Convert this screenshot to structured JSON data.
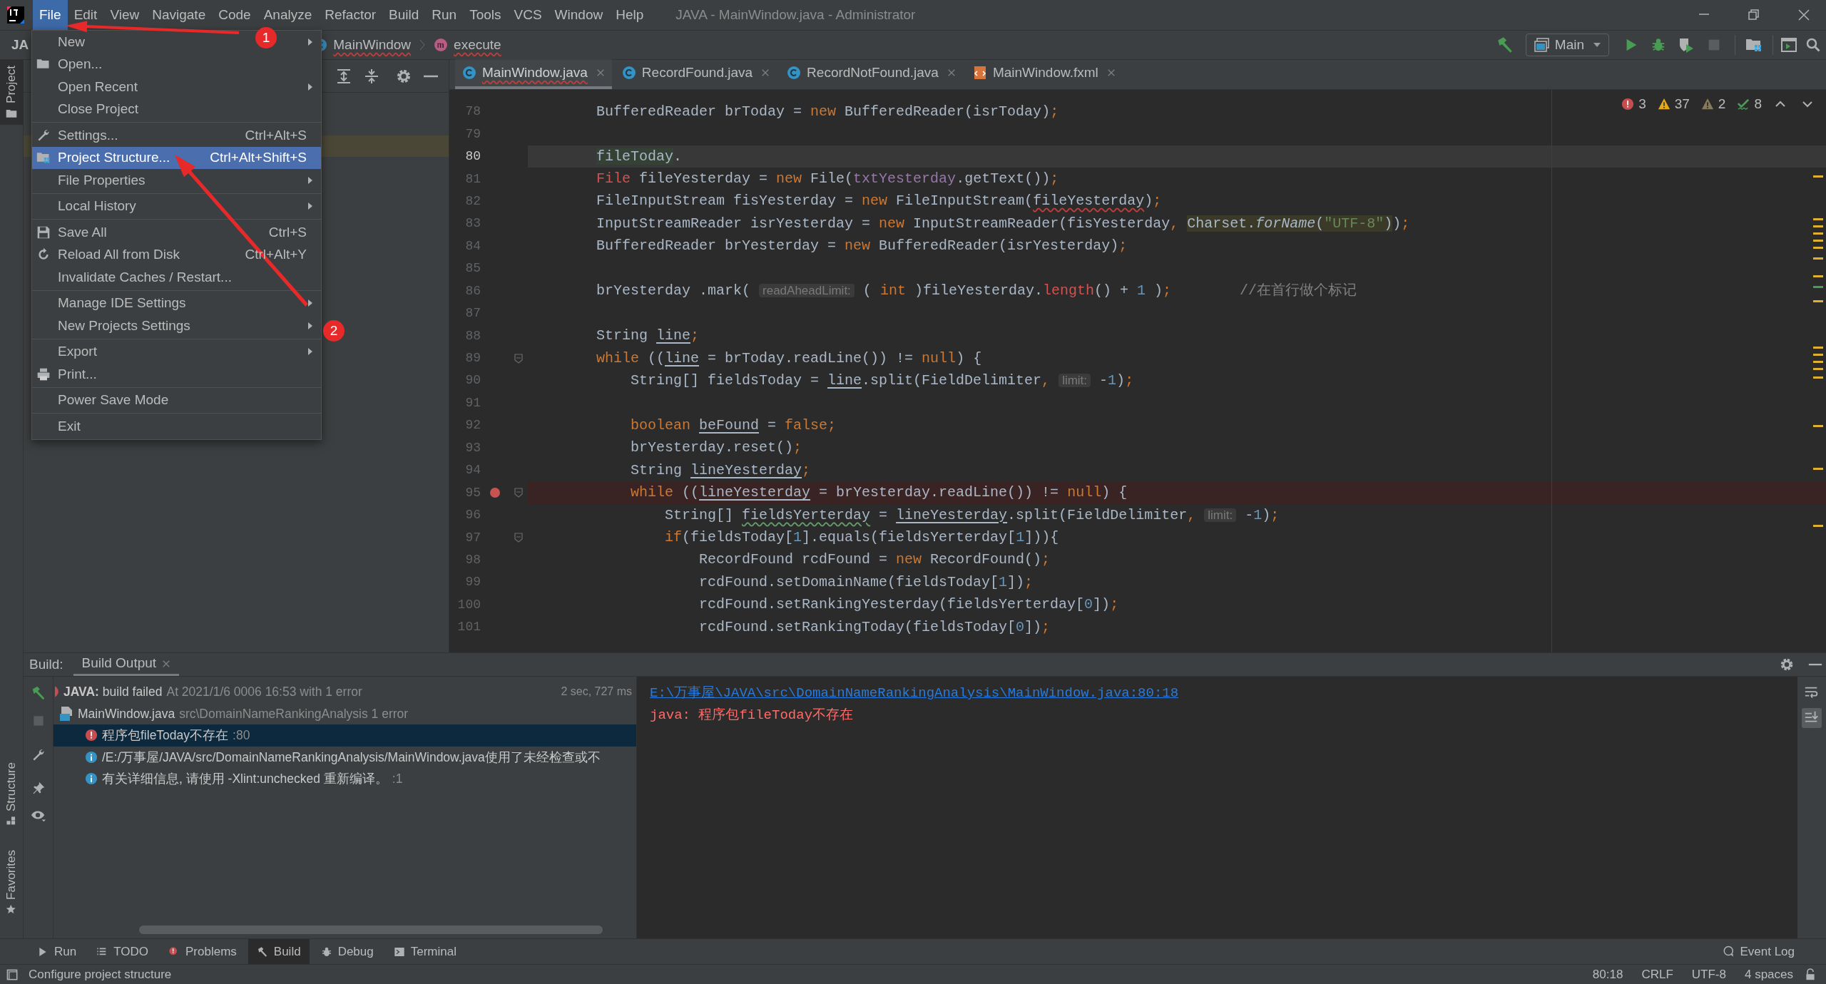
{
  "window": {
    "title": "JAVA - MainWindow.java - Administrator"
  },
  "menu_bar": [
    {
      "label": "File",
      "selected": true
    },
    {
      "label": "Edit",
      "selected": false
    },
    {
      "label": "View",
      "selected": false
    },
    {
      "label": "Navigate",
      "selected": false
    },
    {
      "label": "Code",
      "selected": false
    },
    {
      "label": "Analyze",
      "selected": false
    },
    {
      "label": "Refactor",
      "selected": false
    },
    {
      "label": "Build",
      "selected": false
    },
    {
      "label": "Run",
      "selected": false
    },
    {
      "label": "Tools",
      "selected": false
    },
    {
      "label": "VCS",
      "selected": false
    },
    {
      "label": "Window",
      "selected": false
    },
    {
      "label": "Help",
      "selected": false
    }
  ],
  "navigation": {
    "project": "JA",
    "breadcrumbs": [
      {
        "label": "MainWindow",
        "kind": "class",
        "error": true
      },
      {
        "label": "execute",
        "kind": "method",
        "error": true
      }
    ]
  },
  "run_configuration": "Main",
  "file_menu": [
    {
      "kind": "item",
      "label": "New",
      "submenu": true,
      "selected": false
    },
    {
      "kind": "item",
      "label": "Open...",
      "submenu": false,
      "selected": false
    },
    {
      "kind": "item",
      "label": "Open Recent",
      "submenu": true,
      "selected": false
    },
    {
      "kind": "item",
      "label": "Close Project",
      "submenu": false,
      "selected": false
    },
    {
      "kind": "separator"
    },
    {
      "kind": "item",
      "label": "Settings...",
      "shortcut": "Ctrl+Alt+S",
      "submenu": false,
      "selected": false
    },
    {
      "kind": "item",
      "label": "Project Structure...",
      "shortcut": "Ctrl+Alt+Shift+S",
      "submenu": false,
      "selected": true
    },
    {
      "kind": "item",
      "label": "File Properties",
      "submenu": true,
      "selected": false
    },
    {
      "kind": "separator"
    },
    {
      "kind": "item",
      "label": "Local History",
      "submenu": true,
      "selected": false
    },
    {
      "kind": "separator"
    },
    {
      "kind": "item",
      "label": "Save All",
      "shortcut": "Ctrl+S",
      "submenu": false,
      "selected": false
    },
    {
      "kind": "item",
      "label": "Reload All from Disk",
      "shortcut": "Ctrl+Alt+Y",
      "submenu": false,
      "selected": false
    },
    {
      "kind": "item",
      "label": "Invalidate Caches / Restart...",
      "submenu": false,
      "selected": false
    },
    {
      "kind": "separator"
    },
    {
      "kind": "item",
      "label": "Manage IDE Settings",
      "submenu": true,
      "selected": false
    },
    {
      "kind": "item",
      "label": "New Projects Settings",
      "submenu": true,
      "selected": false
    },
    {
      "kind": "separator"
    },
    {
      "kind": "item",
      "label": "Export",
      "submenu": true,
      "selected": false
    },
    {
      "kind": "item",
      "label": "Print...",
      "submenu": false,
      "selected": false
    },
    {
      "kind": "separator"
    },
    {
      "kind": "item",
      "label": "Power Save Mode",
      "submenu": false,
      "selected": false
    },
    {
      "kind": "separator"
    },
    {
      "kind": "item",
      "label": "Exit",
      "submenu": false,
      "selected": false
    }
  ],
  "annotations": [
    {
      "label": "1"
    },
    {
      "label": "2"
    }
  ],
  "left_tool_tabs": [
    {
      "label": "Project",
      "selected": true
    },
    {
      "label": "Structure",
      "selected": false
    },
    {
      "label": "Favorites",
      "selected": false
    }
  ],
  "editor_tabs": [
    {
      "label": "MainWindow.java",
      "kind": "class",
      "selected": true,
      "error": true
    },
    {
      "label": "RecordFound.java",
      "kind": "class",
      "selected": false,
      "error": false
    },
    {
      "label": "RecordNotFound.java",
      "kind": "class",
      "selected": false,
      "error": false
    },
    {
      "label": "MainWindow.fxml",
      "kind": "fxml",
      "selected": false,
      "error": false
    }
  ],
  "inspections": {
    "errors": "3",
    "warnings": "37",
    "weak_warnings": "2",
    "typos": "8"
  },
  "code_lines": [
    {
      "number": "78",
      "current": false,
      "breakpoint": false,
      "fold": false,
      "tokens": [
        {
          "kind": "p",
          "text": "BufferedReader brToday = "
        },
        {
          "kind": "k",
          "text": "new"
        },
        {
          "kind": "p",
          "text": " BufferedReader(isrToday)"
        },
        {
          "kind": "k",
          "text": ";"
        }
      ]
    },
    {
      "number": "79",
      "current": false,
      "breakpoint": false,
      "fold": false
    },
    {
      "number": "80",
      "current": true,
      "breakpoint": false,
      "fold": false,
      "tokens": [
        {
          "kind": "g",
          "text": "fileToday"
        },
        {
          "kind": "p",
          "text": "."
        }
      ]
    },
    {
      "number": "81",
      "current": false,
      "breakpoint": false,
      "fold": false,
      "tokens": [
        {
          "kind": "err",
          "text": "File"
        },
        {
          "kind": "p",
          "text": " fileYesterday = "
        },
        {
          "kind": "k",
          "text": "new"
        },
        {
          "kind": "p",
          "text": " File("
        },
        {
          "kind": "field",
          "text": "txtYesterday"
        },
        {
          "kind": "p",
          "text": ".getText())"
        },
        {
          "kind": "k",
          "text": ";"
        }
      ]
    },
    {
      "number": "82",
      "current": false,
      "breakpoint": false,
      "fold": false,
      "tokens": [
        {
          "kind": "p",
          "text": "FileInputStream fisYesterday = "
        },
        {
          "kind": "k",
          "text": "new"
        },
        {
          "kind": "p",
          "text": " FileInputStream("
        },
        {
          "kind": "wavy",
          "text": "fileYesterday"
        },
        {
          "kind": "p",
          "text": ")"
        },
        {
          "kind": "k",
          "text": ";"
        }
      ]
    },
    {
      "number": "83",
      "current": false,
      "breakpoint": false,
      "fold": false,
      "tokens": [
        {
          "kind": "p",
          "text": "InputStreamReader isrYesterday = "
        },
        {
          "kind": "k",
          "text": "new"
        },
        {
          "kind": "p",
          "text": " InputStreamReader(fisYesterday"
        },
        {
          "kind": "k",
          "text": ", "
        },
        {
          "kind": "m",
          "text": "Charset."
        },
        {
          "kind": "mi",
          "text": "forName"
        },
        {
          "kind": "m",
          "text": "("
        },
        {
          "kind": "ms",
          "text": "\"UTF-8\""
        },
        {
          "kind": "m",
          "text": ")"
        },
        {
          "kind": "p",
          "text": ")"
        },
        {
          "kind": "k",
          "text": ";"
        }
      ]
    },
    {
      "number": "84",
      "current": false,
      "breakpoint": false,
      "fold": false,
      "tokens": [
        {
          "kind": "p",
          "text": "BufferedReader brYesterday = "
        },
        {
          "kind": "k",
          "text": "new"
        },
        {
          "kind": "p",
          "text": " BufferedReader(isrYesterday)"
        },
        {
          "kind": "k",
          "text": ";"
        }
      ]
    },
    {
      "number": "85",
      "current": false,
      "breakpoint": false,
      "fold": false
    },
    {
      "number": "86",
      "current": false,
      "breakpoint": false,
      "fold": false,
      "tokens": [
        {
          "kind": "p",
          "text": "brYesterday .mark( "
        },
        {
          "kind": "hint",
          "text": "readAheadLimit:"
        },
        {
          "kind": "p",
          "text": " ( "
        },
        {
          "kind": "k",
          "text": "int"
        },
        {
          "kind": "p",
          "text": " )fileYesterday."
        },
        {
          "kind": "err",
          "text": "length"
        },
        {
          "kind": "p",
          "text": "() + "
        },
        {
          "kind": "n",
          "text": "1"
        },
        {
          "kind": "p",
          "text": " )"
        },
        {
          "kind": "k",
          "text": ";"
        },
        {
          "kind": "c",
          "text": "        //在首行做个标记"
        }
      ]
    },
    {
      "number": "87",
      "current": false,
      "breakpoint": false,
      "fold": false
    },
    {
      "number": "88",
      "current": false,
      "breakpoint": false,
      "fold": false,
      "tokens": [
        {
          "kind": "p",
          "text": "String "
        },
        {
          "kind": "u",
          "text": "line"
        },
        {
          "kind": "k",
          "text": ";"
        }
      ]
    },
    {
      "number": "89",
      "current": false,
      "breakpoint": false,
      "fold": true,
      "tokens": [
        {
          "kind": "k",
          "text": "while"
        },
        {
          "kind": "p",
          "text": " (("
        },
        {
          "kind": "u",
          "text": "line"
        },
        {
          "kind": "p",
          "text": " = brToday.readLine()) != "
        },
        {
          "kind": "k",
          "text": "null"
        },
        {
          "kind": "p",
          "text": ") {"
        }
      ],
      "children": [
        {
          "number": "90",
          "current": false,
          "breakpoint": false,
          "fold": false,
          "tokens": [
            {
              "kind": "p",
              "text": "String[] fieldsToday = "
            },
            {
              "kind": "u",
              "text": "line"
            },
            {
              "kind": "p",
              "text": ".split(FieldDelimiter"
            },
            {
              "kind": "k",
              "text": ", "
            },
            {
              "kind": "hint",
              "text": "limit:"
            },
            {
              "kind": "p",
              "text": " -"
            },
            {
              "kind": "n",
              "text": "1"
            },
            {
              "kind": "p",
              "text": ")"
            },
            {
              "kind": "k",
              "text": ";"
            }
          ]
        },
        {
          "number": "91",
          "current": false,
          "breakpoint": false,
          "fold": false
        },
        {
          "number": "92",
          "current": false,
          "breakpoint": false,
          "fold": false,
          "tokens": [
            {
              "kind": "k",
              "text": "boolean "
            },
            {
              "kind": "u",
              "text": "beFound"
            },
            {
              "kind": "p",
              "text": " = "
            },
            {
              "kind": "k",
              "text": "false;"
            }
          ]
        },
        {
          "number": "93",
          "current": false,
          "breakpoint": false,
          "fold": false,
          "tokens": [
            {
              "kind": "p",
              "text": "brYesterday.reset()"
            },
            {
              "kind": "k",
              "text": ";"
            }
          ]
        },
        {
          "number": "94",
          "current": false,
          "breakpoint": false,
          "fold": false,
          "tokens": [
            {
              "kind": "p",
              "text": "String "
            },
            {
              "kind": "u",
              "text": "lineYesterday"
            },
            {
              "kind": "k",
              "text": ";"
            }
          ]
        },
        {
          "number": "95",
          "current": false,
          "breakpoint": true,
          "fold": true,
          "tokens": [
            {
              "kind": "k",
              "text": "while"
            },
            {
              "kind": "p",
              "text": " (("
            },
            {
              "kind": "u",
              "text": "lineYesterday"
            },
            {
              "kind": "p",
              "text": " = brYesterday.readLine()) != "
            },
            {
              "kind": "k",
              "text": "null"
            },
            {
              "kind": "p",
              "text": ") {"
            }
          ],
          "children": [
            {
              "number": "96",
              "current": false,
              "breakpoint": false,
              "fold": false,
              "tokens": [
                {
                  "kind": "p",
                  "text": "String[] "
                },
                {
                  "kind": "typo",
                  "text": "fieldsYerterday"
                },
                {
                  "kind": "p",
                  "text": " = "
                },
                {
                  "kind": "u",
                  "text": "lineYesterday"
                },
                {
                  "kind": "p",
                  "text": ".split(FieldDelimiter"
                },
                {
                  "kind": "k",
                  "text": ", "
                },
                {
                  "kind": "hint",
                  "text": "limit:"
                },
                {
                  "kind": "p",
                  "text": " -"
                },
                {
                  "kind": "n",
                  "text": "1"
                },
                {
                  "kind": "p",
                  "text": ")"
                },
                {
                  "kind": "k",
                  "text": ";"
                }
              ]
            },
            {
              "number": "97",
              "current": false,
              "breakpoint": false,
              "fold": true,
              "tokens": [
                {
                  "kind": "k",
                  "text": "if"
                },
                {
                  "kind": "p",
                  "text": "(fieldsToday["
                },
                {
                  "kind": "n",
                  "text": "1"
                },
                {
                  "kind": "p",
                  "text": "].equals(fieldsYerterday["
                },
                {
                  "kind": "n",
                  "text": "1"
                },
                {
                  "kind": "p",
                  "text": "])){"
                }
              ],
              "children": [
                {
                  "number": "98",
                  "current": false,
                  "breakpoint": false,
                  "fold": false,
                  "tokens": [
                    {
                      "kind": "p",
                      "text": "RecordFound rcdFound = "
                    },
                    {
                      "kind": "k",
                      "text": "new"
                    },
                    {
                      "kind": "p",
                      "text": " RecordFound()"
                    },
                    {
                      "kind": "k",
                      "text": ";"
                    }
                  ]
                },
                {
                  "number": "99",
                  "current": false,
                  "breakpoint": false,
                  "fold": false,
                  "tokens": [
                    {
                      "kind": "p",
                      "text": "rcdFound.setDomainName(fieldsToday["
                    },
                    {
                      "kind": "n",
                      "text": "1"
                    },
                    {
                      "kind": "p",
                      "text": "])"
                    },
                    {
                      "kind": "k",
                      "text": ";"
                    }
                  ]
                },
                {
                  "number": "100",
                  "current": false,
                  "breakpoint": false,
                  "fold": false,
                  "tokens": [
                    {
                      "kind": "p",
                      "text": "rcdFound.setRankingYesterday(fieldsYerterday["
                    },
                    {
                      "kind": "n",
                      "text": "0"
                    },
                    {
                      "kind": "p",
                      "text": "])"
                    },
                    {
                      "kind": "k",
                      "text": ";"
                    }
                  ]
                },
                {
                  "number": "101",
                  "current": false,
                  "breakpoint": false,
                  "fold": false,
                  "tokens": [
                    {
                      "kind": "p",
                      "text": "rcdFound.setRankingToday(fieldsToday["
                    },
                    {
                      "kind": "n",
                      "text": "0"
                    },
                    {
                      "kind": "p",
                      "text": "])"
                    },
                    {
                      "kind": "k",
                      "text": ";"
                    }
                  ]
                }
              ]
            }
          ]
        }
      ]
    }
  ],
  "build_panel": {
    "label": "Build:",
    "tabs": [
      {
        "label": "Build Output",
        "selected": true
      }
    ],
    "tree": [
      {
        "kind": "summary",
        "label": "**JAVA:** build failed",
        "detail": "At 2021/1/6 0006 16:53 with 1 error",
        "duration": "2 sec, 727 ms",
        "selected": false,
        "children": [
          {
            "kind": "file",
            "label": "MainWindow.java",
            "detail": "src\\DomainNameRankingAnalysis 1 error",
            "selected": false,
            "children": [
              {
                "kind": "error",
                "label": "程序包fileToday不存在",
                "detail": ":80",
                "selected": true
              },
              {
                "kind": "info",
                "label": "/E:/万事屋/JAVA/src/DomainNameRankingAnalysis/MainWindow.java使用了未经检查或不",
                "selected": false
              },
              {
                "kind": "info",
                "label": "有关详细信息, 请使用 -Xlint:unchecked 重新编译。",
                "detail": ":1",
                "selected": false
              }
            ]
          }
        ]
      }
    ],
    "output": [
      {
        "kind": "link",
        "text": "E:\\万事屋\\JAVA\\src\\DomainNameRankingAnalysis\\MainWindow.java:80:18"
      },
      {
        "kind": "error",
        "text": "java: 程序包fileToday不存在"
      }
    ]
  },
  "tool_windows": [
    {
      "label": "Run",
      "selected": false
    },
    {
      "label": "TODO",
      "selected": false
    },
    {
      "label": "Problems",
      "selected": false
    },
    {
      "label": "Build",
      "selected": true
    },
    {
      "label": "Debug",
      "selected": false
    },
    {
      "label": "Terminal",
      "selected": false
    }
  ],
  "event_log": "Event Log",
  "status_bar": {
    "message": "Configure project structure",
    "position": "80:18",
    "line_separator": "CRLF",
    "encoding": "UTF-8",
    "indent": "4 spaces"
  }
}
